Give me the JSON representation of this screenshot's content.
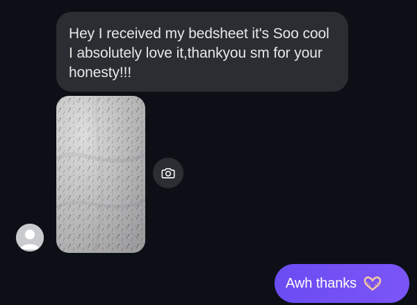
{
  "thread": {
    "incoming_message": {
      "text": "Hey I received my bedsheet it's Soo cool I absolutely love it,thankyou sm for your honesty!!!"
    },
    "incoming_photo": {
      "icon": "bedsheet-photo"
    },
    "photo_action": {
      "icon": "camera-icon"
    },
    "sender_avatar": {
      "icon": "default-avatar-icon"
    },
    "outgoing_message": {
      "text": "Awh thanks",
      "emoji": "heart-hands-emoji"
    }
  },
  "colors": {
    "background": "#0c1016",
    "incoming_bubble": "#2a2d31",
    "outgoing_bubble": "#7352f5"
  }
}
